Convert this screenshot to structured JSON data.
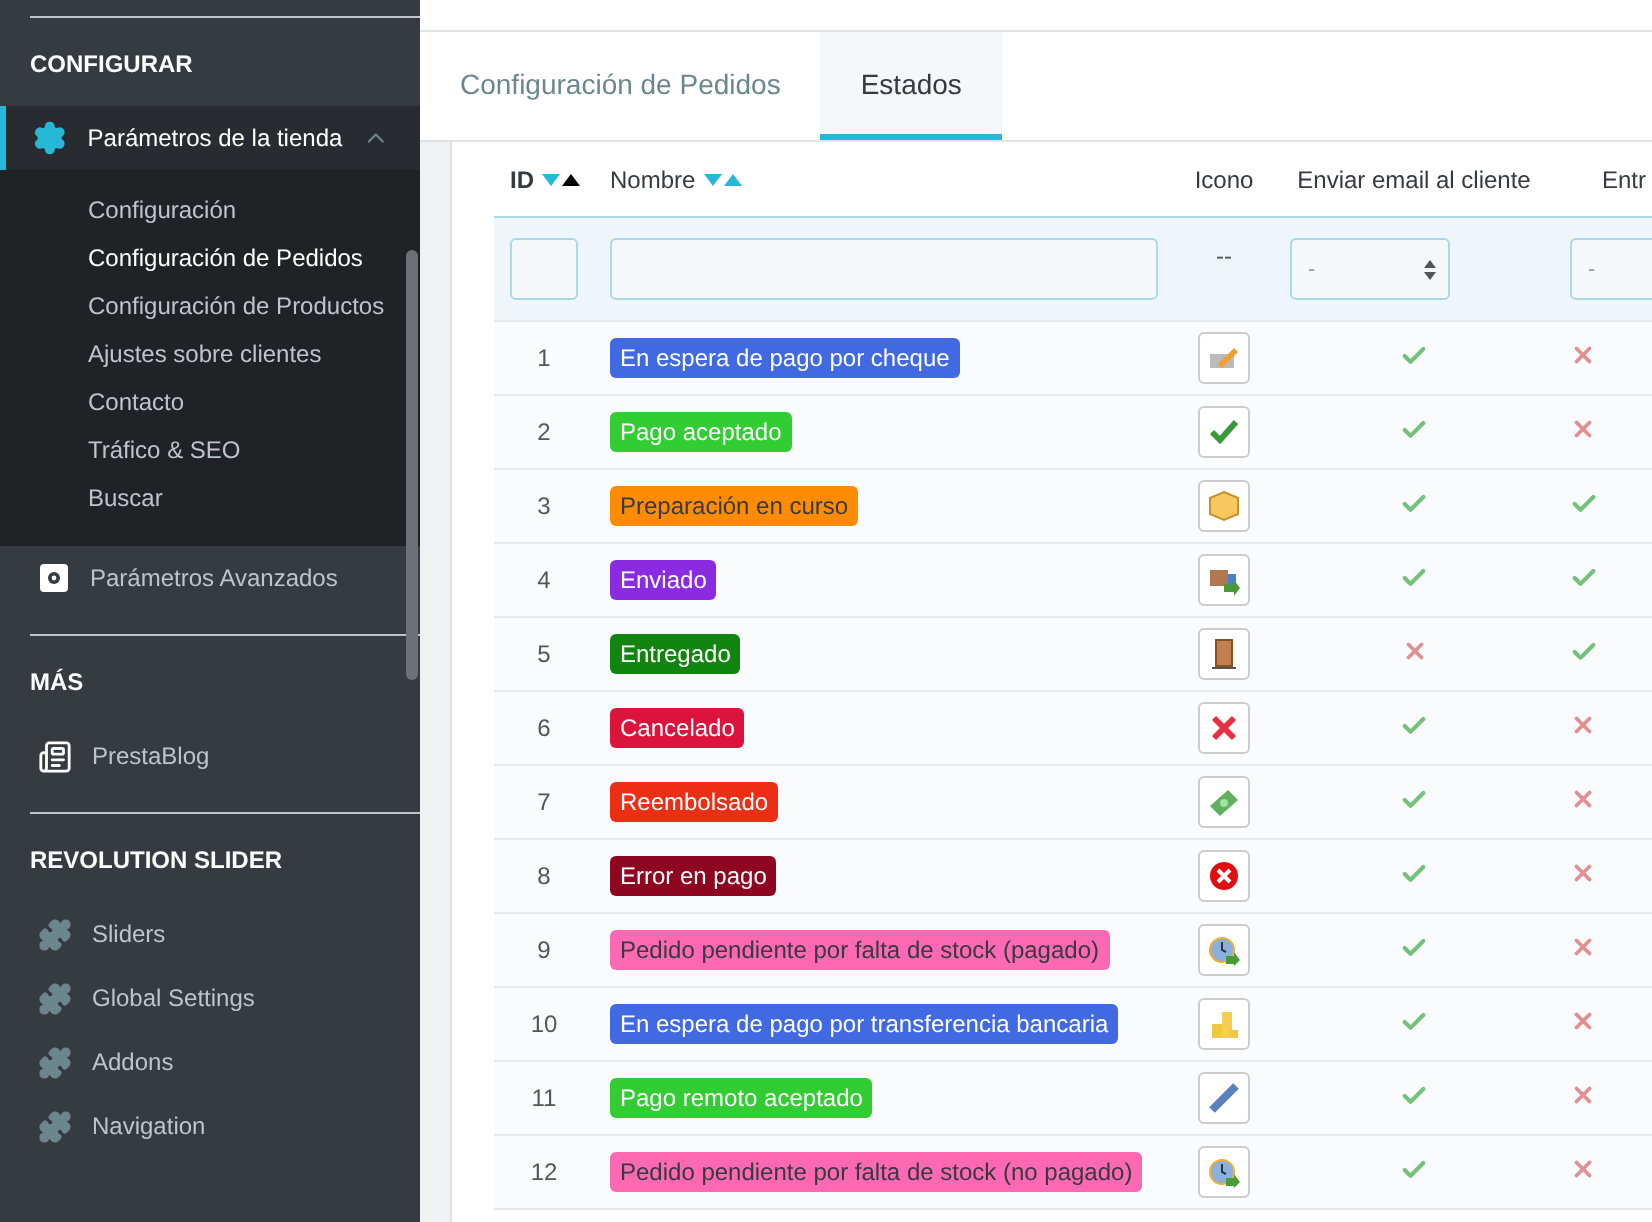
{
  "sidebar": {
    "sections": [
      {
        "title": "CONFIGURAR",
        "items": [
          {
            "label": "Parámetros de la tienda",
            "selected": true,
            "expanded": true,
            "children": [
              {
                "label": "Configuración",
                "selected": false
              },
              {
                "label": "Configuración de Pedidos",
                "selected": true
              },
              {
                "label": "Configuración de Productos",
                "selected": false
              },
              {
                "label": "Ajustes sobre clientes",
                "selected": false
              },
              {
                "label": "Contacto",
                "selected": false
              },
              {
                "label": "Tráfico & SEO",
                "selected": false
              },
              {
                "label": "Buscar",
                "selected": false
              }
            ]
          },
          {
            "label": "Parámetros Avanzados",
            "selected": false,
            "expanded": false
          }
        ]
      },
      {
        "title": "MÁS",
        "items": [
          {
            "label": "PrestaBlog",
            "selected": false,
            "expanded": false
          }
        ]
      },
      {
        "title": "REVOLUTION SLIDER",
        "items": [
          {
            "label": "Sliders",
            "selected": false,
            "expanded": false
          },
          {
            "label": "Global Settings",
            "selected": false,
            "expanded": false
          },
          {
            "label": "Addons",
            "selected": false,
            "expanded": false
          },
          {
            "label": "Navigation",
            "selected": false,
            "expanded": false
          }
        ]
      }
    ]
  },
  "tabs": [
    {
      "label": "Configuración de Pedidos",
      "selected": false
    },
    {
      "label": "Estados",
      "selected": true
    }
  ],
  "table": {
    "columns": [
      {
        "label": "ID",
        "sortable": true,
        "sort_active": true
      },
      {
        "label": "Nombre",
        "sortable": true,
        "sort_active": false
      },
      {
        "label": "Icono",
        "sortable": false,
        "sort_active": false
      },
      {
        "label": "Enviar email al cliente",
        "sortable": false,
        "sort_active": false
      },
      {
        "label": "Entr",
        "sortable": false,
        "sort_active": false
      }
    ],
    "filters": [
      {
        "kind": "input"
      },
      {
        "kind": "input"
      },
      {
        "kind": "text",
        "text": "--"
      },
      {
        "kind": "select",
        "value": "-"
      },
      {
        "kind": "select",
        "value": "-"
      }
    ],
    "rows": [
      {
        "id": "1",
        "name": "En espera de pago por cheque",
        "color": "#4169e1",
        "send_email": true,
        "column_5": false
      },
      {
        "id": "2",
        "name": "Pago aceptado",
        "color": "#32cd32",
        "send_email": true,
        "column_5": false
      },
      {
        "id": "3",
        "name": "Preparación en curso",
        "color": "#ff8c00",
        "send_email": true,
        "column_5": true
      },
      {
        "id": "4",
        "name": "Enviado",
        "color": "#8a2be2",
        "send_email": true,
        "column_5": true
      },
      {
        "id": "5",
        "name": "Entregado",
        "color": "#108510",
        "send_email": false,
        "column_5": true
      },
      {
        "id": "6",
        "name": "Cancelado",
        "color": "#dc143c",
        "send_email": true,
        "column_5": false
      },
      {
        "id": "7",
        "name": "Reembolsado",
        "color": "#ec2e15",
        "send_email": true,
        "column_5": false
      },
      {
        "id": "8",
        "name": "Error en pago",
        "color": "#8f0621",
        "send_email": true,
        "column_5": false
      },
      {
        "id": "9",
        "name": "Pedido pendiente por falta de stock (pagado)",
        "color": "#ff69b4",
        "send_email": true,
        "column_5": false
      },
      {
        "id": "10",
        "name": "En espera de pago por transferencia bancaria",
        "color": "#4169e1",
        "send_email": true,
        "column_5": false
      },
      {
        "id": "11",
        "name": "Pago remoto aceptado",
        "color": "#32cd32",
        "send_email": true,
        "column_5": false
      },
      {
        "id": "12",
        "name": "Pedido pendiente por falta de stock (no pagado)",
        "color": "#ff69b4",
        "send_email": true,
        "column_5": false
      }
    ]
  }
}
